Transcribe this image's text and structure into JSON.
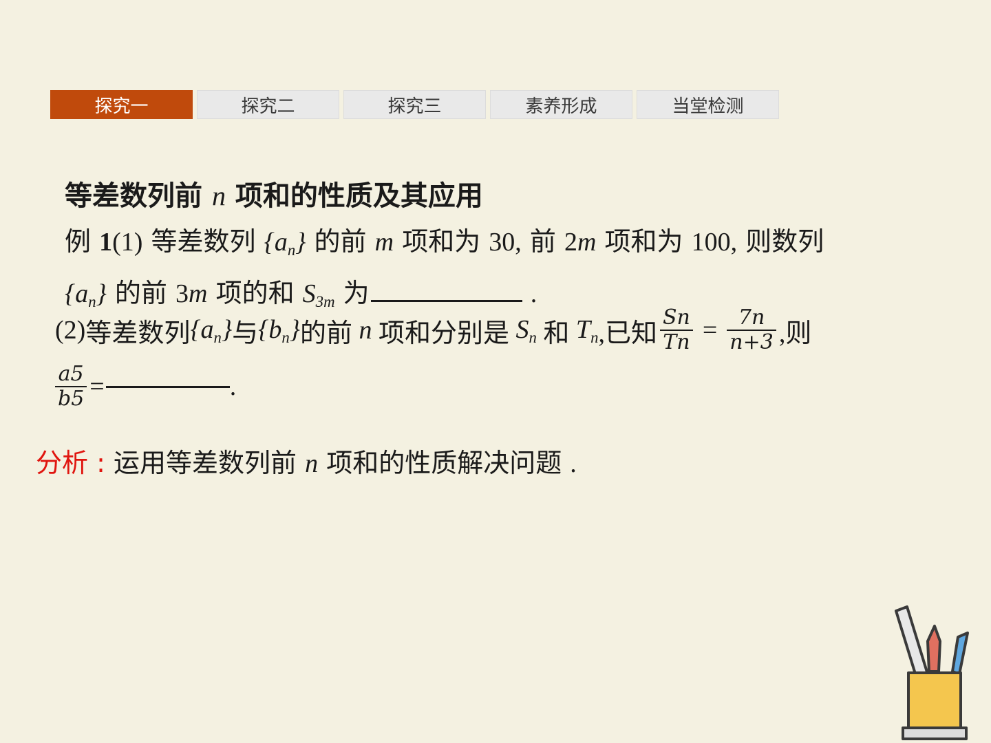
{
  "tabs": [
    {
      "label": "探究一",
      "active": true
    },
    {
      "label": "探究二",
      "active": false
    },
    {
      "label": "探究三",
      "active": false
    },
    {
      "label": "素养形成",
      "active": false
    },
    {
      "label": "当堂检测",
      "active": false
    }
  ],
  "heading": {
    "pre": "等差数列前",
    "var": "n",
    "post": "项和的性质及其应用"
  },
  "example1": {
    "lead": "例",
    "num": "1",
    "part": "(1)",
    "t1": "等差数列",
    "seq": "{a",
    "seq_sub": "n",
    "seq_close": "}",
    "t2": "的前",
    "m": "m",
    "t3": "项和为",
    "v30": "30,",
    "t4": "前",
    "m2": "2",
    "m2v": "m",
    "t5": "项和为",
    "v100": "100,",
    "t6": "则数列",
    "l2_seq": "{a",
    "l2_sub": "n",
    "l2_close": "}",
    "l2_t1": "的前",
    "l2_3": "3",
    "l2_m": "m",
    "l2_t2": "项的和",
    "S": "S",
    "S_sub": "3m",
    "l2_t3": "为",
    "dot": "."
  },
  "example2": {
    "part": "(2)",
    "t1": "等差数列",
    "a": "{a",
    "a_sub": "n",
    "a_close": "}",
    "t2": "与",
    "b": "{b",
    "b_sub": "n",
    "b_close": "}",
    "t3": "的前",
    "n": "n",
    "t4": "项和分别是",
    "S": "S",
    "S_sub": "n",
    "t5": "和",
    "T": "T",
    "T_sub": "n",
    "t6": ",已知",
    "frac1_num": "Sn",
    "frac1_den": "Tn",
    "eq": "=",
    "frac2_num": "7n",
    "frac2_den": "n+3",
    "t7": ",则",
    "frac3_num": "a5",
    "frac3_den": "b5",
    "eq2": "=",
    "end": "."
  },
  "analysis": {
    "label": "分析 :",
    "pre": "运用等差数列前",
    "var": "n",
    "post": "项和的性质解决问题",
    "dot": "."
  },
  "colors": {
    "accent": "#c04a0c",
    "label_red": "#e0150f",
    "background": "#f4f1e1"
  },
  "icons": [
    "pencil-cup-icon"
  ]
}
